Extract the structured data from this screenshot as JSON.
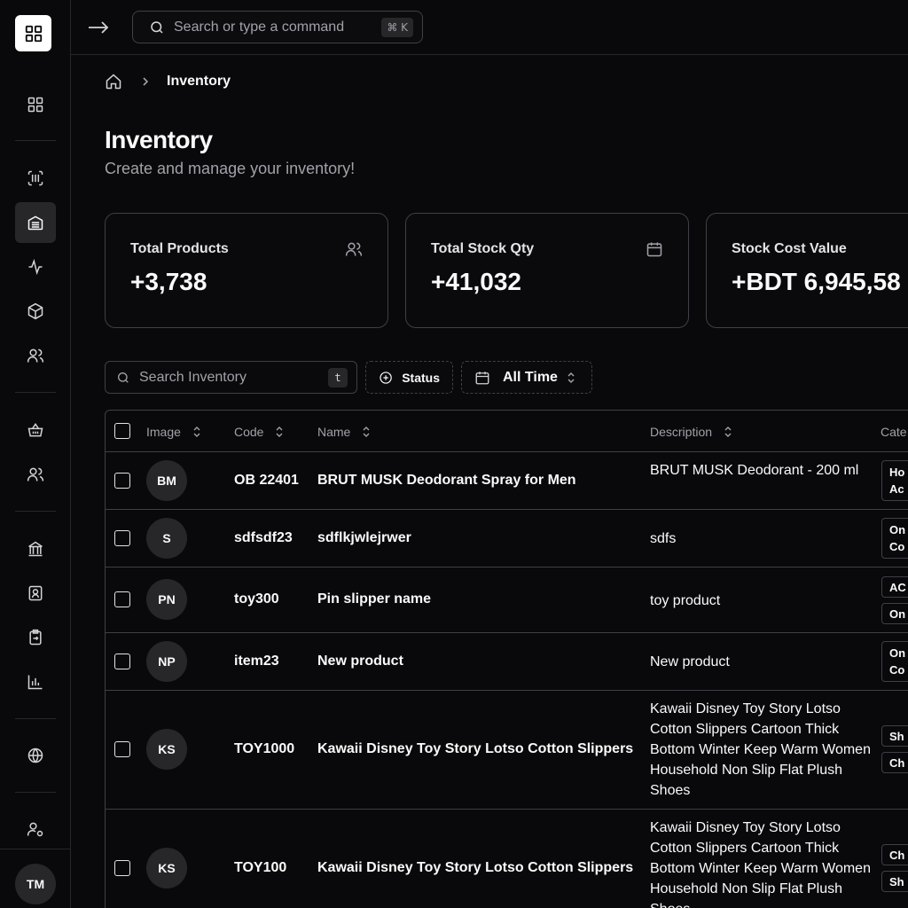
{
  "sidebar": {
    "user_initials": "TM"
  },
  "topbar": {
    "search_placeholder": "Search or type a command",
    "shortcut": "⌘ K"
  },
  "breadcrumb": {
    "current": "Inventory"
  },
  "page": {
    "title": "Inventory",
    "subtitle": "Create and manage your inventory!"
  },
  "stats": [
    {
      "label": "Total Products",
      "value": "+3,738",
      "icon": "users-icon"
    },
    {
      "label": "Total Stock Qty",
      "value": "+41,032",
      "icon": "calendar-icon"
    },
    {
      "label": "Stock Cost Value",
      "value": "+BDT 6,945,58",
      "icon": ""
    }
  ],
  "filters": {
    "search_placeholder": "Search Inventory",
    "search_shortcut": "t",
    "status_label": "Status",
    "time_label": "All Time"
  },
  "table": {
    "columns": [
      "Image",
      "Code",
      "Name",
      "Description",
      "Cate"
    ],
    "rows": [
      {
        "initials": "BM",
        "code": "OB 22401",
        "name": "BRUT MUSK Deodorant Spray for Men",
        "description": "BRUT MUSK Deodorant - 200 ml",
        "tags": [
          "Ho\nAc"
        ]
      },
      {
        "initials": "S",
        "code": "sdfsdf23",
        "name": "sdflkjwlejrwer",
        "description": "sdfs",
        "tags": [
          "On\nCo"
        ]
      },
      {
        "initials": "PN",
        "code": "toy300",
        "name": "Pin slipper name",
        "description": "toy product",
        "tags": [
          "AC",
          "On"
        ]
      },
      {
        "initials": "NP",
        "code": "item23",
        "name": "New product",
        "description": "New product",
        "tags": [
          "On\nCo"
        ]
      },
      {
        "initials": "KS",
        "code": "TOY1000",
        "name": "Kawaii Disney Toy Story Lotso Cotton Slippers",
        "description": "Kawaii Disney Toy Story Lotso Cotton Slippers Cartoon Thick Bottom Winter Keep Warm Women Household Non Slip Flat Plush Shoes",
        "tags": [
          "Sh",
          "Ch"
        ]
      },
      {
        "initials": "KS",
        "code": "TOY100",
        "name": "Kawaii Disney Toy Story Lotso Cotton Slippers",
        "description": "Kawaii Disney Toy Story Lotso Cotton Slippers Cartoon Thick Bottom Winter Keep Warm Women Household Non Slip Flat Plush Shoes",
        "tags": [
          "Ch",
          "Sh"
        ]
      }
    ]
  },
  "colors": {
    "background": "#09090b",
    "border": "#3f3f46",
    "text": "#fafafa",
    "muted": "#a1a1aa"
  }
}
